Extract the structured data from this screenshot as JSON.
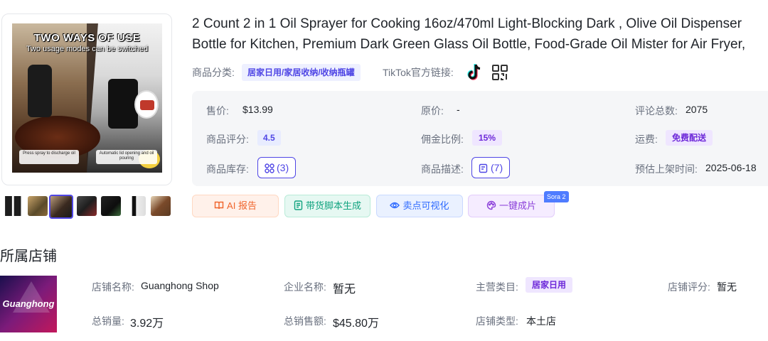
{
  "product": {
    "title": "2 Count 2 in 1 Oil Sprayer for Cooking 16oz/470ml Light-Blocking Dark , Olive Oil Dispenser Bottle for Kitchen, Premium Dark Green Glass Oil Bottle, Food-Grade Oil Mister for Air Fryer, BBQ",
    "image": {
      "headline": "TWO WAYS OF USE",
      "subline": "Two usage modes can be switched",
      "caption_left": "Press spray to discharge oil",
      "caption_right": "Automatic lid opening and oil pouring"
    },
    "thumbnail_count": 7,
    "active_thumbnail": 3
  },
  "category": {
    "label": "商品分类:",
    "value": "居家日用/家居收纳/收纳瓶罐",
    "tiktok_label": "TikTok官方链接:"
  },
  "info": {
    "price_label": "售价:",
    "price_value": "$13.99",
    "original_label": "原价:",
    "original_value": "-",
    "reviews_label": "评论总数:",
    "reviews_value": "2075",
    "rating_label": "商品评分:",
    "rating_value": "4.5",
    "commission_label": "佣金比例:",
    "commission_value": "15%",
    "shipping_label": "运费:",
    "shipping_value": "免费配送",
    "stock_label": "商品库存:",
    "stock_value": "(3)",
    "desc_label": "商品描述:",
    "desc_value": "(7)",
    "launch_label": "预估上架时间:",
    "launch_value": "2025-06-18"
  },
  "actions": {
    "ai_report": "AI 报告",
    "script": "带货脚本生成",
    "visualize": "卖点可视化",
    "one_key": "一键成片",
    "sora_badge": "Sora 2"
  },
  "shop": {
    "section_title": "所属店铺",
    "logo_text": "Guanghong",
    "name_label": "店铺名称:",
    "name_value": "Guanghong Shop",
    "company_label": "企业名称:",
    "company_value": "暂无",
    "main_cat_label": "主营类目:",
    "main_cat_value": "居家日用",
    "score_label": "店铺评分:",
    "score_value": "暂无",
    "sales_label": "总销量:",
    "sales_value": "3.92万",
    "revenue_label": "总销售额:",
    "revenue_value": "$45.80万",
    "type_label": "店铺类型:",
    "type_value": "本土店"
  },
  "colors": {
    "accent": "#4f46e5",
    "purple": "#6d28d9",
    "panel_bg": "#f5f6f8"
  }
}
